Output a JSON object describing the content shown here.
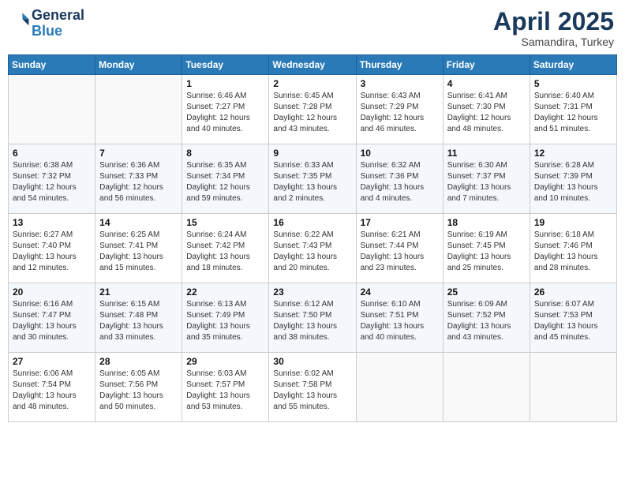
{
  "header": {
    "logo_line1": "General",
    "logo_line2": "Blue",
    "month_year": "April 2025",
    "location": "Samandira, Turkey"
  },
  "weekdays": [
    "Sunday",
    "Monday",
    "Tuesday",
    "Wednesday",
    "Thursday",
    "Friday",
    "Saturday"
  ],
  "weeks": [
    [
      {
        "day": "",
        "sunrise": "",
        "sunset": "",
        "daylight": ""
      },
      {
        "day": "",
        "sunrise": "",
        "sunset": "",
        "daylight": ""
      },
      {
        "day": "1",
        "sunrise": "Sunrise: 6:46 AM",
        "sunset": "Sunset: 7:27 PM",
        "daylight": "Daylight: 12 hours and 40 minutes."
      },
      {
        "day": "2",
        "sunrise": "Sunrise: 6:45 AM",
        "sunset": "Sunset: 7:28 PM",
        "daylight": "Daylight: 12 hours and 43 minutes."
      },
      {
        "day": "3",
        "sunrise": "Sunrise: 6:43 AM",
        "sunset": "Sunset: 7:29 PM",
        "daylight": "Daylight: 12 hours and 46 minutes."
      },
      {
        "day": "4",
        "sunrise": "Sunrise: 6:41 AM",
        "sunset": "Sunset: 7:30 PM",
        "daylight": "Daylight: 12 hours and 48 minutes."
      },
      {
        "day": "5",
        "sunrise": "Sunrise: 6:40 AM",
        "sunset": "Sunset: 7:31 PM",
        "daylight": "Daylight: 12 hours and 51 minutes."
      }
    ],
    [
      {
        "day": "6",
        "sunrise": "Sunrise: 6:38 AM",
        "sunset": "Sunset: 7:32 PM",
        "daylight": "Daylight: 12 hours and 54 minutes."
      },
      {
        "day": "7",
        "sunrise": "Sunrise: 6:36 AM",
        "sunset": "Sunset: 7:33 PM",
        "daylight": "Daylight: 12 hours and 56 minutes."
      },
      {
        "day": "8",
        "sunrise": "Sunrise: 6:35 AM",
        "sunset": "Sunset: 7:34 PM",
        "daylight": "Daylight: 12 hours and 59 minutes."
      },
      {
        "day": "9",
        "sunrise": "Sunrise: 6:33 AM",
        "sunset": "Sunset: 7:35 PM",
        "daylight": "Daylight: 13 hours and 2 minutes."
      },
      {
        "day": "10",
        "sunrise": "Sunrise: 6:32 AM",
        "sunset": "Sunset: 7:36 PM",
        "daylight": "Daylight: 13 hours and 4 minutes."
      },
      {
        "day": "11",
        "sunrise": "Sunrise: 6:30 AM",
        "sunset": "Sunset: 7:37 PM",
        "daylight": "Daylight: 13 hours and 7 minutes."
      },
      {
        "day": "12",
        "sunrise": "Sunrise: 6:28 AM",
        "sunset": "Sunset: 7:39 PM",
        "daylight": "Daylight: 13 hours and 10 minutes."
      }
    ],
    [
      {
        "day": "13",
        "sunrise": "Sunrise: 6:27 AM",
        "sunset": "Sunset: 7:40 PM",
        "daylight": "Daylight: 13 hours and 12 minutes."
      },
      {
        "day": "14",
        "sunrise": "Sunrise: 6:25 AM",
        "sunset": "Sunset: 7:41 PM",
        "daylight": "Daylight: 13 hours and 15 minutes."
      },
      {
        "day": "15",
        "sunrise": "Sunrise: 6:24 AM",
        "sunset": "Sunset: 7:42 PM",
        "daylight": "Daylight: 13 hours and 18 minutes."
      },
      {
        "day": "16",
        "sunrise": "Sunrise: 6:22 AM",
        "sunset": "Sunset: 7:43 PM",
        "daylight": "Daylight: 13 hours and 20 minutes."
      },
      {
        "day": "17",
        "sunrise": "Sunrise: 6:21 AM",
        "sunset": "Sunset: 7:44 PM",
        "daylight": "Daylight: 13 hours and 23 minutes."
      },
      {
        "day": "18",
        "sunrise": "Sunrise: 6:19 AM",
        "sunset": "Sunset: 7:45 PM",
        "daylight": "Daylight: 13 hours and 25 minutes."
      },
      {
        "day": "19",
        "sunrise": "Sunrise: 6:18 AM",
        "sunset": "Sunset: 7:46 PM",
        "daylight": "Daylight: 13 hours and 28 minutes."
      }
    ],
    [
      {
        "day": "20",
        "sunrise": "Sunrise: 6:16 AM",
        "sunset": "Sunset: 7:47 PM",
        "daylight": "Daylight: 13 hours and 30 minutes."
      },
      {
        "day": "21",
        "sunrise": "Sunrise: 6:15 AM",
        "sunset": "Sunset: 7:48 PM",
        "daylight": "Daylight: 13 hours and 33 minutes."
      },
      {
        "day": "22",
        "sunrise": "Sunrise: 6:13 AM",
        "sunset": "Sunset: 7:49 PM",
        "daylight": "Daylight: 13 hours and 35 minutes."
      },
      {
        "day": "23",
        "sunrise": "Sunrise: 6:12 AM",
        "sunset": "Sunset: 7:50 PM",
        "daylight": "Daylight: 13 hours and 38 minutes."
      },
      {
        "day": "24",
        "sunrise": "Sunrise: 6:10 AM",
        "sunset": "Sunset: 7:51 PM",
        "daylight": "Daylight: 13 hours and 40 minutes."
      },
      {
        "day": "25",
        "sunrise": "Sunrise: 6:09 AM",
        "sunset": "Sunset: 7:52 PM",
        "daylight": "Daylight: 13 hours and 43 minutes."
      },
      {
        "day": "26",
        "sunrise": "Sunrise: 6:07 AM",
        "sunset": "Sunset: 7:53 PM",
        "daylight": "Daylight: 13 hours and 45 minutes."
      }
    ],
    [
      {
        "day": "27",
        "sunrise": "Sunrise: 6:06 AM",
        "sunset": "Sunset: 7:54 PM",
        "daylight": "Daylight: 13 hours and 48 minutes."
      },
      {
        "day": "28",
        "sunrise": "Sunrise: 6:05 AM",
        "sunset": "Sunset: 7:56 PM",
        "daylight": "Daylight: 13 hours and 50 minutes."
      },
      {
        "day": "29",
        "sunrise": "Sunrise: 6:03 AM",
        "sunset": "Sunset: 7:57 PM",
        "daylight": "Daylight: 13 hours and 53 minutes."
      },
      {
        "day": "30",
        "sunrise": "Sunrise: 6:02 AM",
        "sunset": "Sunset: 7:58 PM",
        "daylight": "Daylight: 13 hours and 55 minutes."
      },
      {
        "day": "",
        "sunrise": "",
        "sunset": "",
        "daylight": ""
      },
      {
        "day": "",
        "sunrise": "",
        "sunset": "",
        "daylight": ""
      },
      {
        "day": "",
        "sunrise": "",
        "sunset": "",
        "daylight": ""
      }
    ]
  ]
}
